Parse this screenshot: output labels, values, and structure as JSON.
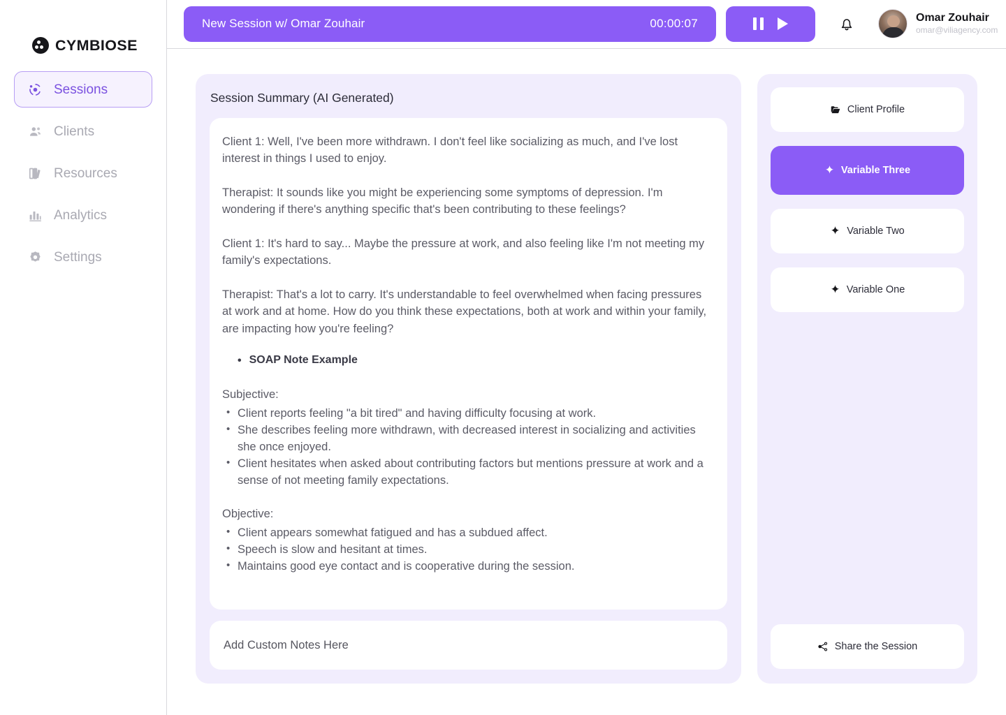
{
  "brand": {
    "name": "CYMBIOSE",
    "logo_icon": "cymbiose-logo-icon"
  },
  "sidebar": {
    "items": [
      {
        "label": "Sessions",
        "icon": "sessions-icon",
        "active": true
      },
      {
        "label": "Clients",
        "icon": "clients-icon",
        "active": false
      },
      {
        "label": "Resources",
        "icon": "resources-icon",
        "active": false
      },
      {
        "label": "Analytics",
        "icon": "analytics-icon",
        "active": false
      },
      {
        "label": "Settings",
        "icon": "settings-icon",
        "active": false
      }
    ]
  },
  "topbar": {
    "session_title": "New Session w/ Omar Zouhair",
    "session_timer": "00:00:07",
    "transport": {
      "pause_icon": "pause-icon",
      "play_icon": "play-icon"
    },
    "bell_icon": "notification-bell-icon",
    "user": {
      "name": "Omar Zouhair",
      "email": "omar@viliagency.com",
      "avatar_icon": "user-avatar"
    }
  },
  "summary": {
    "title": "Session Summary (AI Generated)",
    "paragraphs": [
      "Client 1: Well, I've been more withdrawn. I don't feel like socializing as much, and I've lost interest in things I used to enjoy.",
      "Therapist: It sounds like you might be experiencing some symptoms of depression. I'm wondering if there's anything specific that's been contributing to these feelings?",
      "Client 1: It's hard to say... Maybe the pressure at work, and also feeling like I'm not meeting my family's expectations.",
      "Therapist: That's a lot to carry. It's understandable to feel overwhelmed when facing pressures at work and at home. How do you think these expectations, both at work and within your family, are impacting how you're feeling?"
    ],
    "soap_heading": "SOAP Note Example",
    "sections": [
      {
        "label": "Subjective:",
        "items": [
          "Client reports feeling \"a bit tired\" and having difficulty focusing at work.",
          "She describes feeling more withdrawn, with decreased interest in socializing and activities she once enjoyed.",
          "Client hesitates when asked about contributing factors but mentions pressure at work and a sense of not meeting family expectations."
        ]
      },
      {
        "label": "Objective:",
        "items": [
          "Client appears somewhat fatigued and has a subdued affect.",
          "Speech is slow and hesitant at times.",
          "Maintains good eye contact and is cooperative during the session."
        ]
      }
    ],
    "notes_placeholder": "Add Custom Notes Here"
  },
  "rail": {
    "client_profile": {
      "label": "Client Profile",
      "icon": "folder-icon"
    },
    "variable_three": {
      "label": "Variable Three",
      "icon": "sparkle-icon"
    },
    "variable_two": {
      "label": "Variable Two",
      "icon": "sparkle-icon"
    },
    "variable_one": {
      "label": "Variable One",
      "icon": "sparkle-icon"
    },
    "share": {
      "label": "Share the Session",
      "icon": "share-nodes-icon"
    }
  },
  "colors": {
    "accent": "#8B5CF6",
    "panel_bg": "#F1EDFD",
    "active_nav_text": "#7B52E0",
    "body_text": "#5B5B66",
    "muted_text": "#A9A9B2"
  }
}
